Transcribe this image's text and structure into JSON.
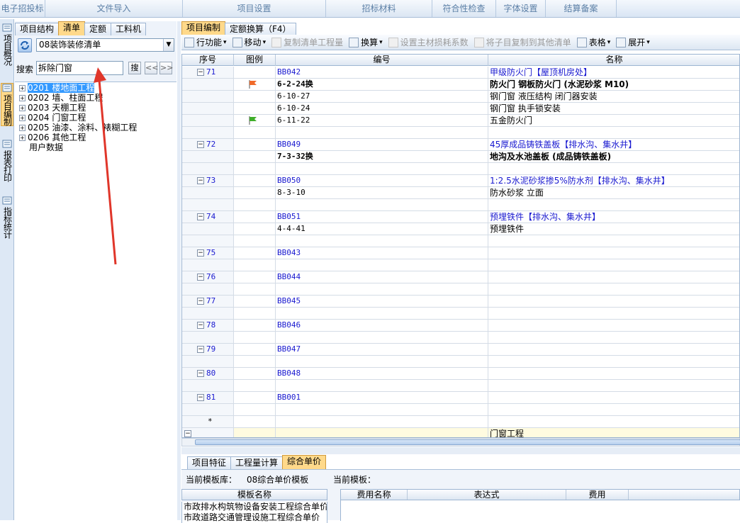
{
  "topbar": {
    "items": [
      "电子招投标",
      "文件导入",
      "项目设置",
      "招标材料",
      "符合性检查",
      "字体设置",
      "结算备案"
    ]
  },
  "vtabs": [
    "项目概况",
    "项目编制",
    "报表打印",
    "指标统计"
  ],
  "left": {
    "tabs": [
      "项目结构",
      "清单",
      "定额",
      "工料机"
    ],
    "combo": "08装饰装修清单",
    "search_label": "搜索",
    "search_value": "拆除门窗",
    "search_btn": "搜",
    "prev": "<<",
    "next": ">>",
    "tree": [
      {
        "code": "0201",
        "name": "楼地面工程",
        "selected": true
      },
      {
        "code": "0202",
        "name": "墙、柱面工程",
        "selected": false
      },
      {
        "code": "0203",
        "name": "天棚工程",
        "selected": false
      },
      {
        "code": "0204",
        "name": "门窗工程",
        "selected": false
      },
      {
        "code": "0205",
        "name": "油漆、涂料、裱糊工程",
        "selected": false
      },
      {
        "code": "0206",
        "name": "其他工程",
        "selected": false
      }
    ],
    "user_data": "用户数据"
  },
  "right": {
    "tabs": [
      "项目编制",
      "定额换算（F4）"
    ],
    "toolbar": [
      "行功能",
      "移动",
      "复制清单工程量",
      "换算",
      "设置主材损耗系数",
      "将子目复制到其他清单",
      "表格",
      "展开"
    ],
    "headers": [
      "序号",
      "图例",
      "编号",
      "名称"
    ],
    "rows": [
      {
        "seq": "71",
        "code": "BB042",
        "name": "甲级防火门【屋顶机房处】",
        "type": "item"
      },
      {
        "seq": "",
        "code": "6-2-24换",
        "name": "防火门 钢板防火门 (水泥砂浆 M10)",
        "type": "bold",
        "flag": "orange"
      },
      {
        "seq": "",
        "code": "6-10-27",
        "name": "钢门窗 液压结构 闭门器安装",
        "type": "sub"
      },
      {
        "seq": "",
        "code": "6-10-24",
        "name": "钢门窗 执手锁安装",
        "type": "sub"
      },
      {
        "seq": "",
        "code": "6-11-22",
        "name": "五金防火门",
        "type": "sub",
        "flag": "green"
      },
      {
        "seq": "",
        "code": "",
        "name": "",
        "type": "blank"
      },
      {
        "seq": "72",
        "code": "BB049",
        "name": "45厚成品铸铁盖板【排水沟、集水井】",
        "type": "item"
      },
      {
        "seq": "",
        "code": "7-3-32换",
        "name": "地沟及水池盖板 (成品铸铁盖板)",
        "type": "bold"
      },
      {
        "seq": "",
        "code": "",
        "name": "",
        "type": "blank"
      },
      {
        "seq": "73",
        "code": "BB050",
        "name": "1:2.5水泥砂浆掺5%防水剂【排水沟、集水井】",
        "type": "item"
      },
      {
        "seq": "",
        "code": "8-3-10",
        "name": "防水砂浆 立面",
        "type": "sub"
      },
      {
        "seq": "",
        "code": "",
        "name": "",
        "type": "blank"
      },
      {
        "seq": "74",
        "code": "BB051",
        "name": "预埋铁件【排水沟、集水井】",
        "type": "item"
      },
      {
        "seq": "",
        "code": "4-4-41",
        "name": "预埋铁件",
        "type": "sub"
      },
      {
        "seq": "",
        "code": "",
        "name": "",
        "type": "blank"
      },
      {
        "seq": "75",
        "code": "BB043",
        "name": "",
        "type": "item"
      },
      {
        "seq": "",
        "code": "",
        "name": "",
        "type": "blank"
      },
      {
        "seq": "76",
        "code": "BB044",
        "name": "",
        "type": "item"
      },
      {
        "seq": "",
        "code": "",
        "name": "",
        "type": "blank"
      },
      {
        "seq": "77",
        "code": "BB045",
        "name": "",
        "type": "item"
      },
      {
        "seq": "",
        "code": "",
        "name": "",
        "type": "blank"
      },
      {
        "seq": "78",
        "code": "BB046",
        "name": "",
        "type": "item"
      },
      {
        "seq": "",
        "code": "",
        "name": "",
        "type": "blank"
      },
      {
        "seq": "79",
        "code": "BB047",
        "name": "",
        "type": "item"
      },
      {
        "seq": "",
        "code": "",
        "name": "",
        "type": "blank"
      },
      {
        "seq": "80",
        "code": "BB048",
        "name": "",
        "type": "item"
      },
      {
        "seq": "",
        "code": "",
        "name": "",
        "type": "blank"
      },
      {
        "seq": "81",
        "code": "BB001",
        "name": "",
        "type": "item"
      },
      {
        "seq": "",
        "code": "",
        "name": "",
        "type": "blank"
      },
      {
        "seq": "*",
        "code": "",
        "name": "",
        "type": "star"
      },
      {
        "seq": "",
        "code": "",
        "name": "门窗工程",
        "type": "footer"
      }
    ]
  },
  "bottom": {
    "tabs": [
      "项目特征",
      "工程量计算",
      "综合单价"
    ],
    "lib_label": "当前模板库：",
    "lib_value": "08综合单价模板",
    "tmpl_label": "当前模板：",
    "tmpl_header": "模板名称",
    "tmpl_rows": [
      "市政排水构筑物设备安装工程综合单价",
      "市政道路交通管理设施工程综合单价"
    ],
    "fee_headers": [
      "费用名称",
      "表达式",
      "费用"
    ]
  }
}
